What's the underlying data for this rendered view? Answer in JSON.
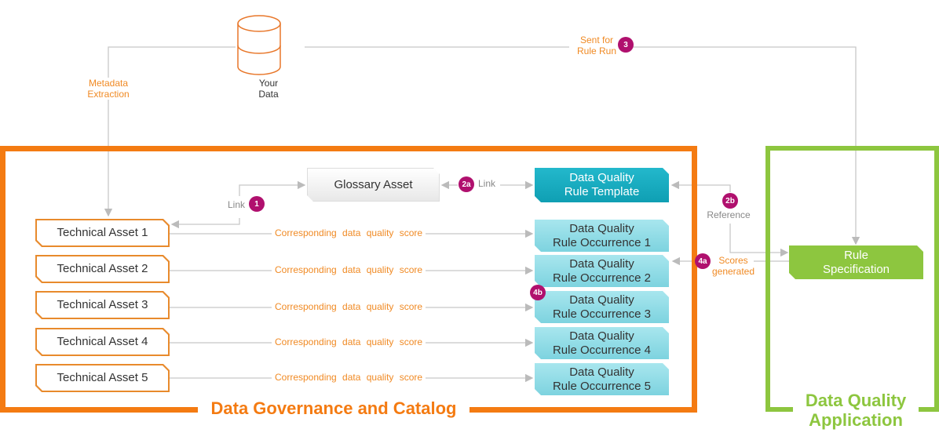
{
  "data_source": {
    "label_line1": "Your",
    "label_line2": "Data",
    "icon": "database-icon"
  },
  "metadata_extraction": {
    "line1": "Metadata",
    "line2": "Extraction"
  },
  "sent_for_rule_run": {
    "line1": "Sent for",
    "line2": "Rule Run",
    "badge": "3"
  },
  "governance": {
    "title": "Data Governance and Catalog"
  },
  "dq_app": {
    "title_line1": "Data Quality",
    "title_line2": "Application"
  },
  "glossary_asset": "Glossary Asset",
  "link1": {
    "label": "Link",
    "badge": "1"
  },
  "link2a": {
    "label": "Link",
    "badge": "2a"
  },
  "rule_template": {
    "line1": "Data Quality",
    "line2": "Rule Template"
  },
  "reference": {
    "label": "Reference",
    "badge": "2b"
  },
  "scores": {
    "line1": "Scores",
    "line2": "generated",
    "badge": "4a"
  },
  "badge_4b": "4b",
  "rule_spec": {
    "line1": "Rule",
    "line2": "Specification"
  },
  "score_label": "Corresponding data quality score",
  "technical_assets": [
    "Technical Asset 1",
    "Technical Asset 2",
    "Technical Asset 3",
    "Technical Asset 4",
    "Technical Asset 5"
  ],
  "occurrences": [
    {
      "line1": "Data Quality",
      "line2": "Rule Occurrence 1"
    },
    {
      "line1": "Data Quality",
      "line2": "Rule Occurrence 2"
    },
    {
      "line1": "Data Quality",
      "line2": "Rule Occurrence 3"
    },
    {
      "line1": "Data Quality",
      "line2": "Rule Occurrence 4"
    },
    {
      "line1": "Data Quality",
      "line2": "Rule Occurrence 5"
    }
  ],
  "colors": {
    "governance": "#f47b12",
    "dq_app": "#8dc63f",
    "template": "#1aaec4",
    "occurrence": "#8fdbe5",
    "badge": "#b0106e"
  }
}
